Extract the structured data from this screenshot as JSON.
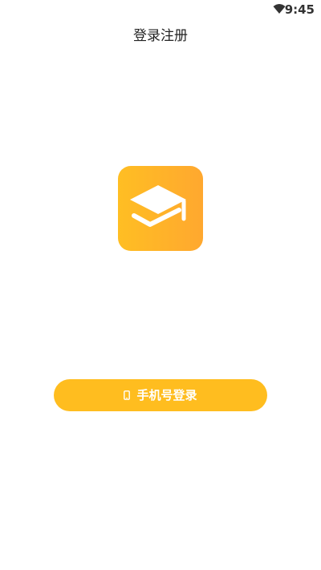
{
  "status_bar": {
    "time": "9:45",
    "wifi_icon": "wifi-icon"
  },
  "header": {
    "title": "登录注册"
  },
  "logo": {
    "icon": "graduation-cap-icon",
    "gradient_start": "#ffbe23",
    "gradient_end": "#ffa82f"
  },
  "login": {
    "button_label": "手机号登录",
    "button_icon": "phone-icon",
    "button_color": "#ffbd1f"
  }
}
